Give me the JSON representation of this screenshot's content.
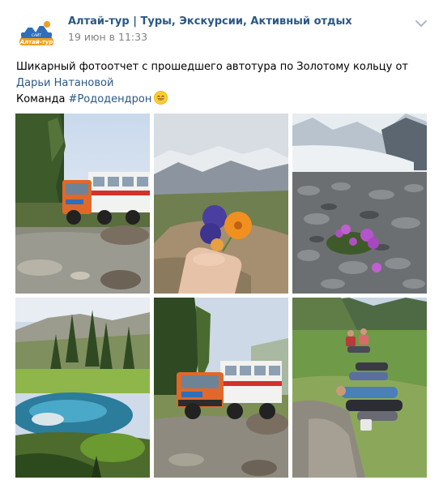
{
  "group": {
    "name": "Алтай-тур | Туры, Экскурсии, Активный отдых",
    "date": "19 июн в 11:33",
    "logo_lines": [
      "САЙТ",
      "Алтай-тур"
    ]
  },
  "post": {
    "text_main": "Шикарный фотоотчет с прошедшего автотура по Золотому кольцу от ",
    "author_link": "Дарьи Натановой",
    "team_prefix": "Команда ",
    "hashtag": "#Рододендрон",
    "emoji_icon": "smiling-face-emoji"
  },
  "photos": [
    {
      "subject": "orange-truck-crossing-river"
    },
    {
      "subject": "hand-holding-wildflowers"
    },
    {
      "subject": "purple-flowers-on-rocks-glacier"
    },
    {
      "subject": "blue-geyser-lake"
    },
    {
      "subject": "orange-truck-in-forest"
    },
    {
      "subject": "tourists-resting-on-rocks"
    }
  ],
  "colors": {
    "link": "#2a5885",
    "date": "#828282",
    "truck_orange": "#e0682a",
    "logo_blue": "#2f6fb8",
    "logo_orange": "#f0a020"
  }
}
